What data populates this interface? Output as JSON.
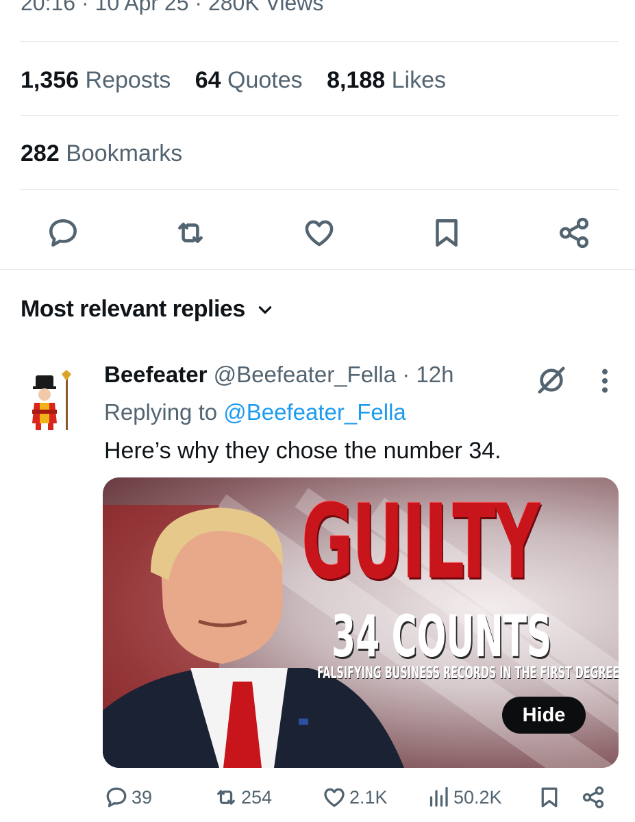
{
  "post_meta": {
    "time": "20:16",
    "date": "10 Apr 25",
    "views": "280K Views",
    "sep": "·"
  },
  "stats": {
    "reposts_count": "1,356",
    "reposts_label": "Reposts",
    "quotes_count": "64",
    "quotes_label": "Quotes",
    "likes_count": "8,188",
    "likes_label": "Likes",
    "bookmarks_count": "282",
    "bookmarks_label": "Bookmarks"
  },
  "action_icons": [
    "reply-icon",
    "repost-icon",
    "like-icon",
    "bookmark-icon",
    "share-icon"
  ],
  "replies_header": {
    "label": "Most relevant replies"
  },
  "reply": {
    "display_name": "Beefeater",
    "handle": "@Beefeater_Fella",
    "sep": "·",
    "age": "12h",
    "replying_prefix": "Replying to",
    "replying_to": "@Beefeater_Fella",
    "text": "Here’s why they chose the number 34.",
    "media": {
      "headline": "GUILTY",
      "subheadline": "34 COUNTS",
      "caption": "FALSIFYING BUSINESS RECORDS IN THE FIRST DEGREE",
      "hide_label": "Hide"
    },
    "metrics": {
      "replies": "39",
      "reposts": "254",
      "likes": "2.1K",
      "views": "50.2K"
    }
  },
  "colors": {
    "text_primary": "#0f1419",
    "text_secondary": "#536471",
    "link": "#1d9bf0",
    "divider": "#e6e8ea",
    "headline_red": "#c8141b"
  }
}
